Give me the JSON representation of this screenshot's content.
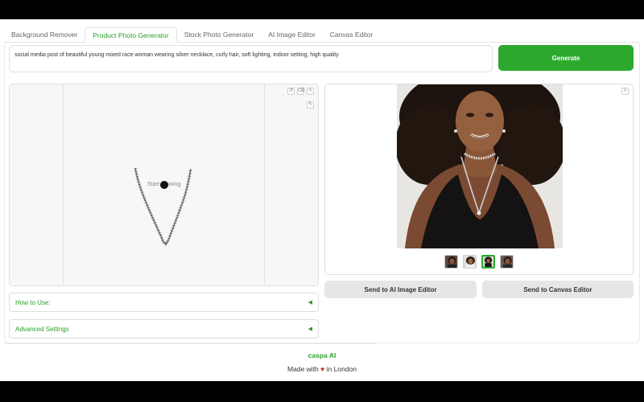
{
  "tabs": [
    {
      "label": "Background Remover"
    },
    {
      "label": "Product Photo Generator"
    },
    {
      "label": "Stock Photo Generator"
    },
    {
      "label": "AI Image Editor"
    },
    {
      "label": "Canvas Editor"
    }
  ],
  "active_tab": "Product Photo Generator",
  "prompt": {
    "value": "social media post of beautiful young mixed race woman wearing silver necklace, curly hair, soft lighting, indoor setting, high quality"
  },
  "generate_label": "Generate",
  "canvas": {
    "hint": "Start drawing",
    "tools": [
      "undo-icon",
      "clear-icon",
      "close-icon",
      "brush-icon"
    ]
  },
  "accordions": {
    "how_to_use": "How to Use:",
    "advanced": "Advanced Settings",
    "arrow": "◀"
  },
  "result": {
    "close": "×",
    "thumbnail_count": 4,
    "selected_thumbnail": 3
  },
  "actions": {
    "send_ai_editor": "Send to AI Image Editor",
    "send_canvas_editor": "Send to Canvas Editor"
  },
  "footer": {
    "brand": "caspa AI",
    "made_prefix": "Made with",
    "heart": "♥",
    "made_suffix": "in London"
  },
  "colors": {
    "accent": "#2daa2d",
    "heart": "#e02020"
  }
}
